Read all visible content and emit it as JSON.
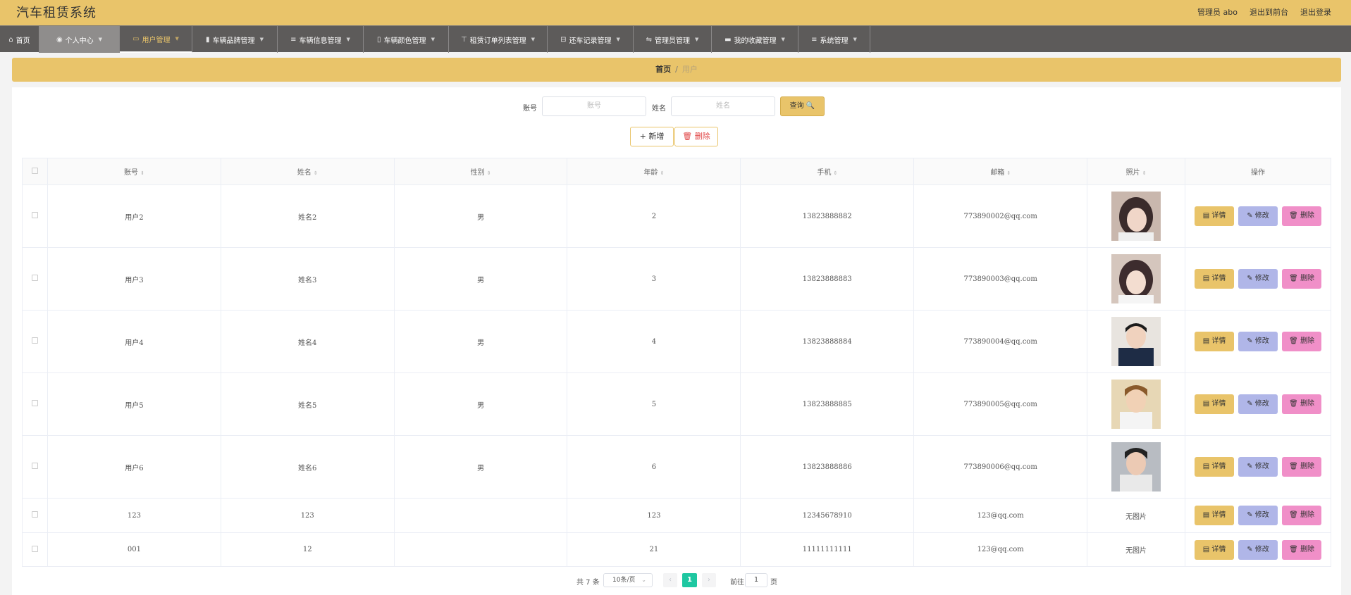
{
  "header": {
    "title": "汽车租赁系统",
    "admin": "管理员 abo",
    "front_link": "退出到前台",
    "logout_link": "退出登录"
  },
  "nav": [
    {
      "label": "首页",
      "icon": "⌂"
    },
    {
      "label": "个人中心",
      "icon": "◉"
    },
    {
      "label": "用户管理",
      "icon": "▭"
    },
    {
      "label": "车辆品牌管理",
      "icon": "▮"
    },
    {
      "label": "车辆信息管理",
      "icon": "≡"
    },
    {
      "label": "车辆颜色管理",
      "icon": "▯"
    },
    {
      "label": "租赁订单列表管理",
      "icon": "⊤"
    },
    {
      "label": "还车记录管理",
      "icon": "⊟"
    },
    {
      "label": "管理员管理",
      "icon": "⇋"
    },
    {
      "label": "我的收藏管理",
      "icon": "▬"
    },
    {
      "label": "系统管理",
      "icon": "≡"
    }
  ],
  "breadcrumb": {
    "home": "首页",
    "sep": "/",
    "current": "用户"
  },
  "search": {
    "account_label": "账号",
    "account_placeholder": "账号",
    "name_label": "姓名",
    "name_placeholder": "姓名",
    "button": "查询 🔍"
  },
  "actions": {
    "add": "+ 新增",
    "delete": "🗑 删除"
  },
  "table": {
    "headers": [
      "账号",
      "姓名",
      "性别",
      "年龄",
      "手机",
      "邮箱",
      "照片",
      "操作"
    ],
    "rows": [
      {
        "account": "用户2",
        "name": "姓名2",
        "gender": "男",
        "age": "2",
        "phone": "13823888882",
        "email": "773890002@qq.com",
        "photo": "girl-1"
      },
      {
        "account": "用户3",
        "name": "姓名3",
        "gender": "男",
        "age": "3",
        "phone": "13823888883",
        "email": "773890003@qq.com",
        "photo": "girl-2"
      },
      {
        "account": "用户4",
        "name": "姓名4",
        "gender": "男",
        "age": "4",
        "phone": "13823888884",
        "email": "773890004@qq.com",
        "photo": "boy-1"
      },
      {
        "account": "用户5",
        "name": "姓名5",
        "gender": "男",
        "age": "5",
        "phone": "13823888885",
        "email": "773890005@qq.com",
        "photo": "boy-2"
      },
      {
        "account": "用户6",
        "name": "姓名6",
        "gender": "男",
        "age": "6",
        "phone": "13823888886",
        "email": "773890006@qq.com",
        "photo": "boy-3"
      },
      {
        "account": "123",
        "name": "123",
        "gender": "",
        "age": "123",
        "phone": "12345678910",
        "email": "123@qq.com",
        "photo": "无图片"
      },
      {
        "account": "001",
        "name": "12",
        "gender": "",
        "age": "21",
        "phone": "11111111111",
        "email": "123@qq.com",
        "photo": "无图片"
      }
    ],
    "row_actions": {
      "detail": "详情",
      "edit": "修改",
      "remove": "删除"
    }
  },
  "pager": {
    "total": "共 7 条",
    "page_size": "10条/页",
    "current": "1",
    "goto": "前往",
    "goto_value": "1",
    "page_word": "页"
  },
  "colors": {
    "accent": "#e9c46a",
    "nav_bg": "#5d5b5a",
    "pager_active": "#1ec7a1",
    "edit": "#b0b6e8",
    "remove": "#f08fc8"
  }
}
